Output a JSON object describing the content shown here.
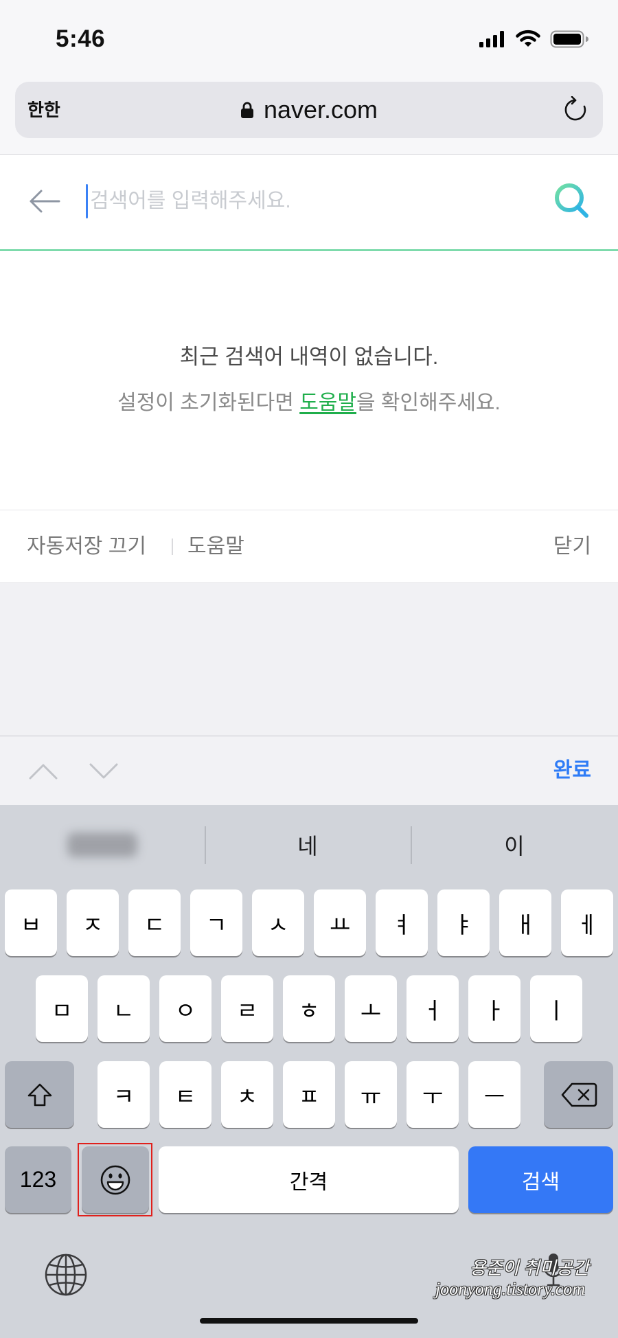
{
  "status_bar": {
    "time": "5:46",
    "icons": [
      "cellular-signal-icon",
      "wifi-icon",
      "battery-icon"
    ]
  },
  "browser": {
    "reader_button": "한한",
    "url": "naver.com",
    "icons": [
      "lock-icon",
      "reload-icon"
    ]
  },
  "search": {
    "placeholder": "검색어를 입력해주세요.",
    "icons": [
      "back-arrow-icon",
      "search-icon"
    ]
  },
  "recent_searches": {
    "empty_message": "최근 검색어 내역이 없습니다.",
    "help_prefix": "설정이 초기화된다면 ",
    "help_link": "도움말",
    "help_suffix": "을 확인해주세요."
  },
  "footer": {
    "autosave_toggle": "자동저장 끄기",
    "help": "도움말",
    "close": "닫기"
  },
  "accessory_bar": {
    "icons": [
      "chevron-up-icon",
      "chevron-down-icon"
    ],
    "done": "완료"
  },
  "keyboard": {
    "suggestions": {
      "first_blurred": true,
      "second": "네",
      "third": "이"
    },
    "rows": [
      [
        "ㅂ",
        "ㅈ",
        "ㄷ",
        "ㄱ",
        "ㅅ",
        "ㅛ",
        "ㅕ",
        "ㅑ",
        "ㅐ",
        "ㅔ"
      ],
      [
        "ㅁ",
        "ㄴ",
        "ㅇ",
        "ㄹ",
        "ㅎ",
        "ㅗ",
        "ㅓ",
        "ㅏ",
        "ㅣ"
      ],
      [
        "ㅋ",
        "ㅌ",
        "ㅊ",
        "ㅍ",
        "ㅠ",
        "ㅜ",
        "ㅡ"
      ]
    ],
    "numbers_key": "123",
    "space_key": "간격",
    "return_key": "검색",
    "icons": [
      "shift-icon",
      "delete-icon",
      "emoji-icon",
      "globe-icon",
      "microphone-icon"
    ]
  },
  "watermark": {
    "line1": "용준이 취미공간",
    "line2": "joonyong.tistory.com"
  },
  "colors": {
    "search_underline": "#5bd196",
    "help_link": "#1fae4b",
    "done": "#2f7cf6",
    "return_key": "#3478f6",
    "cursor": "#3b82f6",
    "highlight": "#e0201c"
  }
}
